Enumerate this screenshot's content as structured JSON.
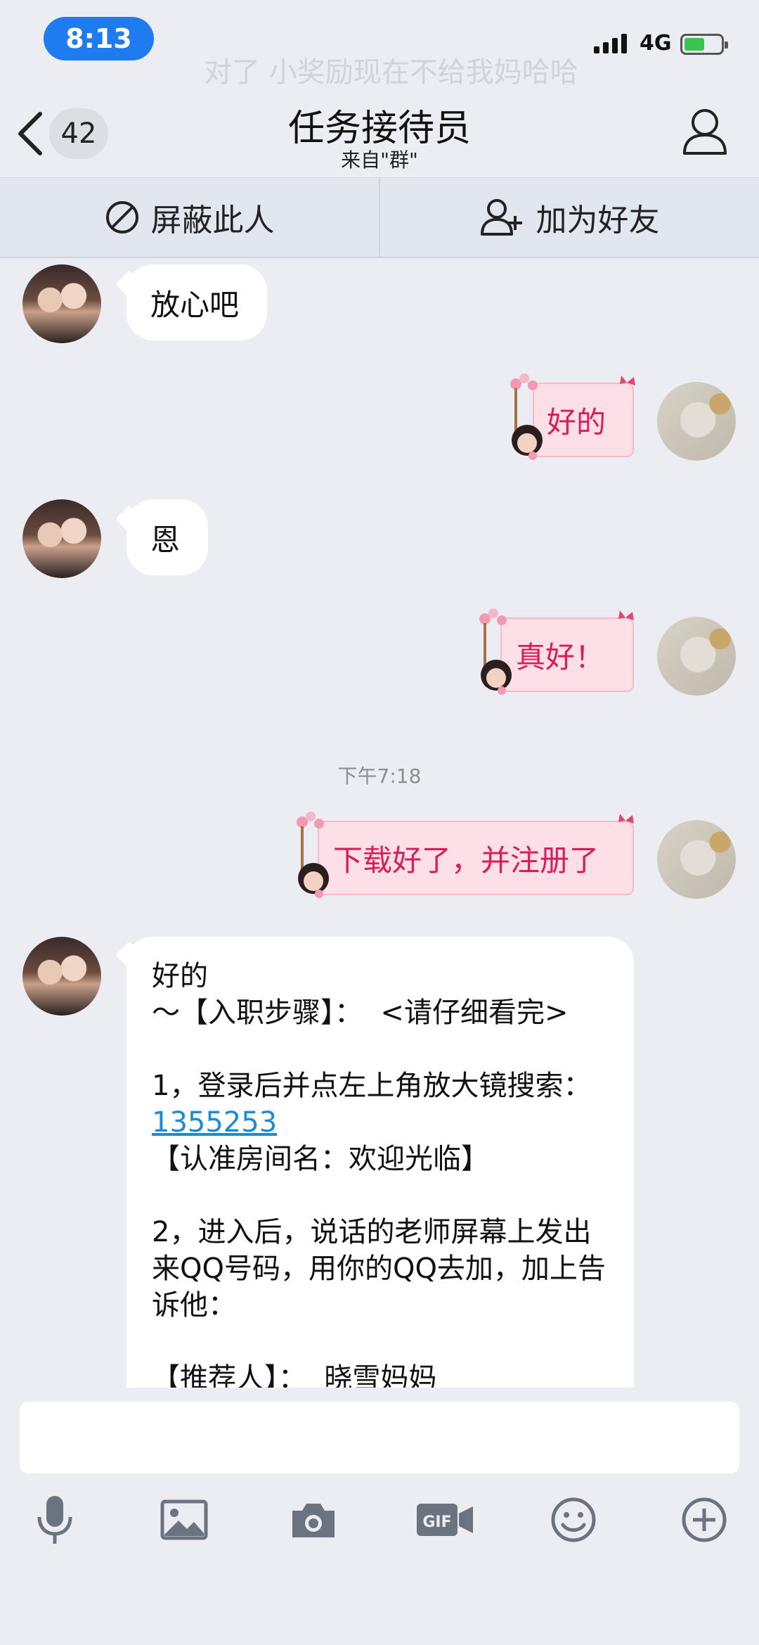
{
  "status": {
    "time": "8:13",
    "network": "4G"
  },
  "nav": {
    "unread_count": "42",
    "title": "任务接待员",
    "subtitle": "来自\"群\""
  },
  "actions": {
    "block_label": "屏蔽此人",
    "add_friend_label": "加为好友"
  },
  "messages": [
    {
      "side": "left",
      "text": "放心吧"
    },
    {
      "side": "right",
      "text": "好的"
    },
    {
      "side": "left",
      "text": "恩"
    },
    {
      "side": "right",
      "text": "真好！"
    },
    {
      "side": "right",
      "text": "下载好了，并注册了"
    }
  ],
  "timestamp": "下午7:18",
  "long_message": {
    "line1": "好的",
    "line2": "～【入职步骤】：  <请仔细看完>",
    "line3a": "1，登录后并点左上角放大镜搜索：",
    "link": "1355253",
    "line3b": "【认准房间名：欢迎光临】",
    "line4": "2，进入后，说话的老师屏幕上发出来QQ号码，用你的QQ去加，加上告诉他：",
    "line5": "【推荐人】：  晓雪妈妈"
  },
  "bg_text": "对了 小奖励现在不给我妈哈哈",
  "toolbar": [
    "microphone-icon",
    "image-icon",
    "camera-icon",
    "gif-icon",
    "emoji-icon",
    "plus-icon"
  ],
  "colors": {
    "accent": "#1f7cf0",
    "bubble_pink": "#fde0e7",
    "pink_text": "#d81d5d",
    "link": "#1a8bd8",
    "background": "#ebedf3"
  }
}
